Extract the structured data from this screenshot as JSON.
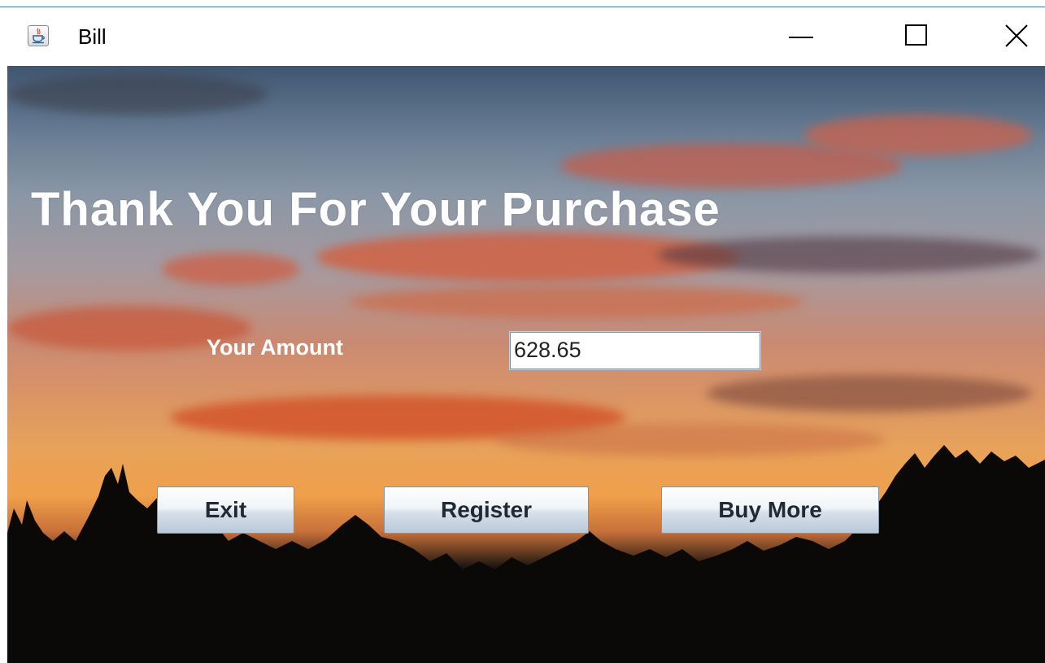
{
  "window": {
    "title": "Bill",
    "app_icon": "java-cup-icon",
    "controls": {
      "minimize_icon": "minimize-icon",
      "maximize_icon": "maximize-icon",
      "close_icon": "close-icon"
    }
  },
  "main": {
    "heading": "Thank You For Your Purchase",
    "amount_label": "Your Amount",
    "amount_value": "628.65",
    "buttons": {
      "exit": "Exit",
      "register": "Register",
      "buy_more": "Buy More"
    }
  },
  "colors": {
    "heading_text": "#ffffff",
    "button_text": "#1f2a36",
    "title_border": "#3b7fb0"
  }
}
